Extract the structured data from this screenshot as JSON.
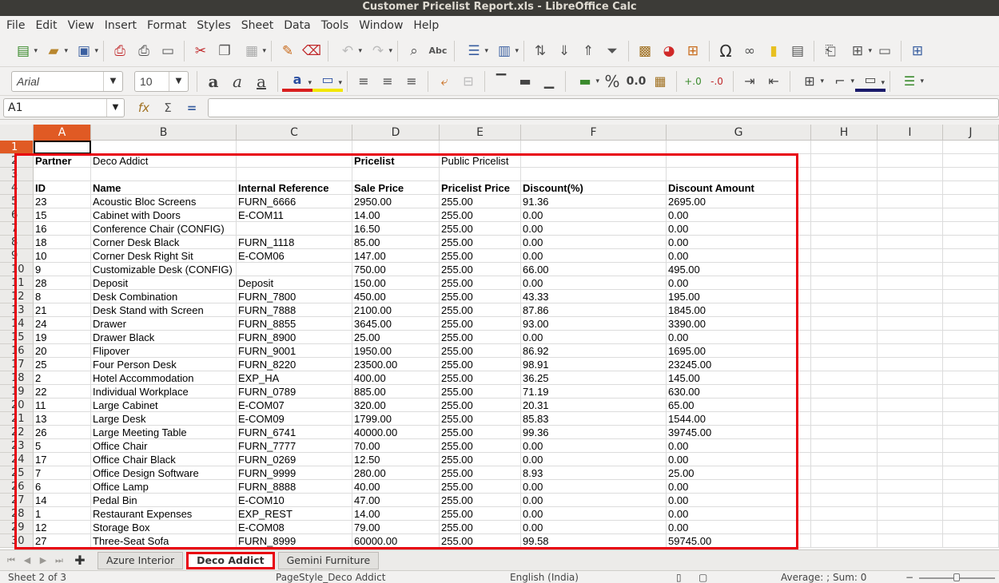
{
  "window": {
    "title": "Customer Pricelist Report.xls - LibreOffice Calc"
  },
  "menu": [
    "File",
    "Edit",
    "View",
    "Insert",
    "Format",
    "Styles",
    "Sheet",
    "Data",
    "Tools",
    "Window",
    "Help"
  ],
  "format_bar": {
    "font_name": "Arial",
    "font_size": "10",
    "currency_label": "%",
    "decimal_label": "0.0"
  },
  "formula_bar": {
    "cell_ref": "A1",
    "content": ""
  },
  "columns": [
    "A",
    "B",
    "C",
    "D",
    "E",
    "F",
    "G",
    "H",
    "I",
    "J"
  ],
  "rows": [
    [
      "",
      "",
      "",
      "",
      "",
      "",
      ""
    ],
    [
      "Partner",
      "Deco Addict",
      "",
      "Pricelist",
      "Public Pricelist",
      "",
      ""
    ],
    [
      "",
      "",
      "",
      "",
      "",
      "",
      ""
    ],
    [
      "ID",
      "Name",
      "Internal Reference",
      "Sale Price",
      "Pricelist Price",
      "Discount(%)",
      "Discount Amount"
    ],
    [
      "23",
      "Acoustic Bloc Screens",
      "FURN_6666",
      "2950.00",
      "255.00",
      "91.36",
      "2695.00"
    ],
    [
      "15",
      "Cabinet with Doors",
      "E-COM11",
      "14.00",
      "255.00",
      "0.00",
      "0.00"
    ],
    [
      "16",
      "Conference Chair (CONFIG)",
      "",
      "16.50",
      "255.00",
      "0.00",
      "0.00"
    ],
    [
      "18",
      "Corner Desk Black",
      "FURN_1118",
      "85.00",
      "255.00",
      "0.00",
      "0.00"
    ],
    [
      "10",
      "Corner Desk Right Sit",
      "E-COM06",
      "147.00",
      "255.00",
      "0.00",
      "0.00"
    ],
    [
      "9",
      "Customizable Desk (CONFIG)",
      "",
      "750.00",
      "255.00",
      "66.00",
      "495.00"
    ],
    [
      "28",
      "Deposit",
      "Deposit",
      "150.00",
      "255.00",
      "0.00",
      "0.00"
    ],
    [
      "8",
      "Desk Combination",
      "FURN_7800",
      "450.00",
      "255.00",
      "43.33",
      "195.00"
    ],
    [
      "21",
      "Desk Stand with Screen",
      "FURN_7888",
      "2100.00",
      "255.00",
      "87.86",
      "1845.00"
    ],
    [
      "24",
      "Drawer",
      "FURN_8855",
      "3645.00",
      "255.00",
      "93.00",
      "3390.00"
    ],
    [
      "19",
      "Drawer Black",
      "FURN_8900",
      "25.00",
      "255.00",
      "0.00",
      "0.00"
    ],
    [
      "20",
      "Flipover",
      "FURN_9001",
      "1950.00",
      "255.00",
      "86.92",
      "1695.00"
    ],
    [
      "25",
      "Four Person Desk",
      "FURN_8220",
      "23500.00",
      "255.00",
      "98.91",
      "23245.00"
    ],
    [
      "2",
      "Hotel Accommodation",
      "EXP_HA",
      "400.00",
      "255.00",
      "36.25",
      "145.00"
    ],
    [
      "22",
      "Individual Workplace",
      "FURN_0789",
      "885.00",
      "255.00",
      "71.19",
      "630.00"
    ],
    [
      "11",
      "Large Cabinet",
      "E-COM07",
      "320.00",
      "255.00",
      "20.31",
      "65.00"
    ],
    [
      "13",
      "Large Desk",
      "E-COM09",
      "1799.00",
      "255.00",
      "85.83",
      "1544.00"
    ],
    [
      "26",
      "Large Meeting Table",
      "FURN_6741",
      "40000.00",
      "255.00",
      "99.36",
      "39745.00"
    ],
    [
      "5",
      "Office Chair",
      "FURN_7777",
      "70.00",
      "255.00",
      "0.00",
      "0.00"
    ],
    [
      "17",
      "Office Chair Black",
      "FURN_0269",
      "12.50",
      "255.00",
      "0.00",
      "0.00"
    ],
    [
      "7",
      "Office Design Software",
      "FURN_9999",
      "280.00",
      "255.00",
      "8.93",
      "25.00"
    ],
    [
      "6",
      "Office Lamp",
      "FURN_8888",
      "40.00",
      "255.00",
      "0.00",
      "0.00"
    ],
    [
      "14",
      "Pedal Bin",
      "E-COM10",
      "47.00",
      "255.00",
      "0.00",
      "0.00"
    ],
    [
      "1",
      "Restaurant Expenses",
      "EXP_REST",
      "14.00",
      "255.00",
      "0.00",
      "0.00"
    ],
    [
      "12",
      "Storage Box",
      "E-COM08",
      "79.00",
      "255.00",
      "0.00",
      "0.00"
    ],
    [
      "27",
      "Three-Seat Sofa",
      "FURN_8999",
      "60000.00",
      "255.00",
      "99.58",
      "59745.00"
    ]
  ],
  "sheet_tabs": [
    "Azure Interior",
    "Deco Addict",
    "Gemini Furniture"
  ],
  "active_tab": "Deco Addict",
  "status": {
    "sheet": "Sheet 2 of 3",
    "page_style": "PageStyle_Deco Addict",
    "language": "English (India)",
    "sum": "Average: ; Sum: 0"
  },
  "colors": {
    "accent": "#e05a24",
    "highlight_box": "#e8000f"
  }
}
